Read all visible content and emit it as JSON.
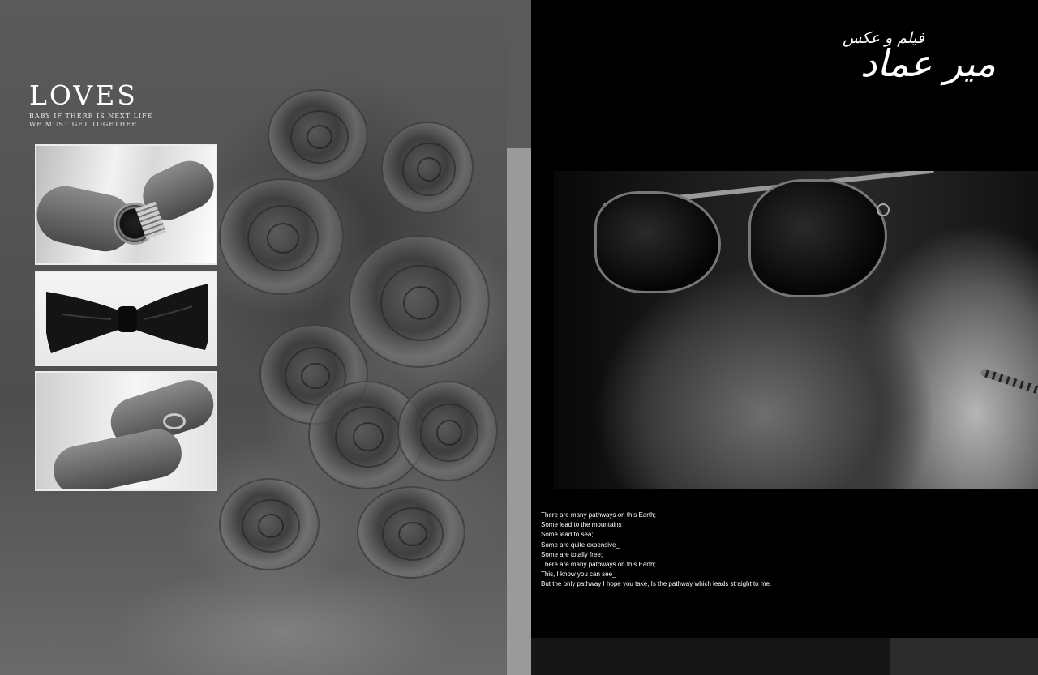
{
  "left_page": {
    "title": "LOVES",
    "subtitle_lines": [
      "BABY IF THERE IS NEXT LIFE",
      "WE MUST GET TOGETHER"
    ],
    "photos": [
      {
        "subject": "watch-icon"
      },
      {
        "subject": "bowtie-icon"
      },
      {
        "subject": "ring-icon"
      }
    ]
  },
  "right_page": {
    "logo": {
      "main": "میر عماد",
      "sub": "فیلم و عکس"
    },
    "poem_lines": [
      "There are many pathways on this Earth;",
      "Some lead to the mountains_",
      "Some lead to sea;",
      "Some are quite expensive_",
      "Some are totally free;",
      "There are many pathways on this Earth;",
      "This, I know you can see_",
      "But the only pathway I hope you take,  Is  the pathway which leads straight to me."
    ]
  }
}
